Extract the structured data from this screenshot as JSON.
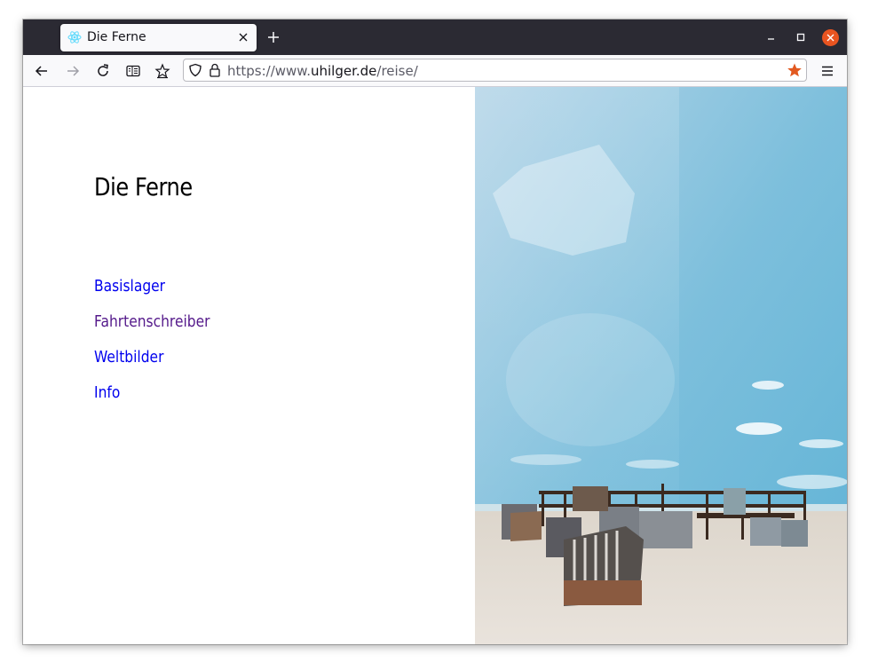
{
  "browser": {
    "tab_title": "Die Ferne",
    "url_prefix": "https://www.",
    "url_domain": "uhilger.de",
    "url_path": "/reise/"
  },
  "page": {
    "title": "Die Ferne",
    "nav": [
      {
        "label": "Basislager",
        "visited": false
      },
      {
        "label": "Fahrtenschreiber",
        "visited": true
      },
      {
        "label": "Weltbilder",
        "visited": false
      },
      {
        "label": "Info",
        "visited": false
      }
    ],
    "image_description_icon": "beach-chairs-photo"
  },
  "colors": {
    "titlebar": "#2b2a33",
    "link": "#0000ee",
    "link_visited": "#551a8b",
    "bookmark_star": "#e25920",
    "close_button": "#e95420"
  }
}
